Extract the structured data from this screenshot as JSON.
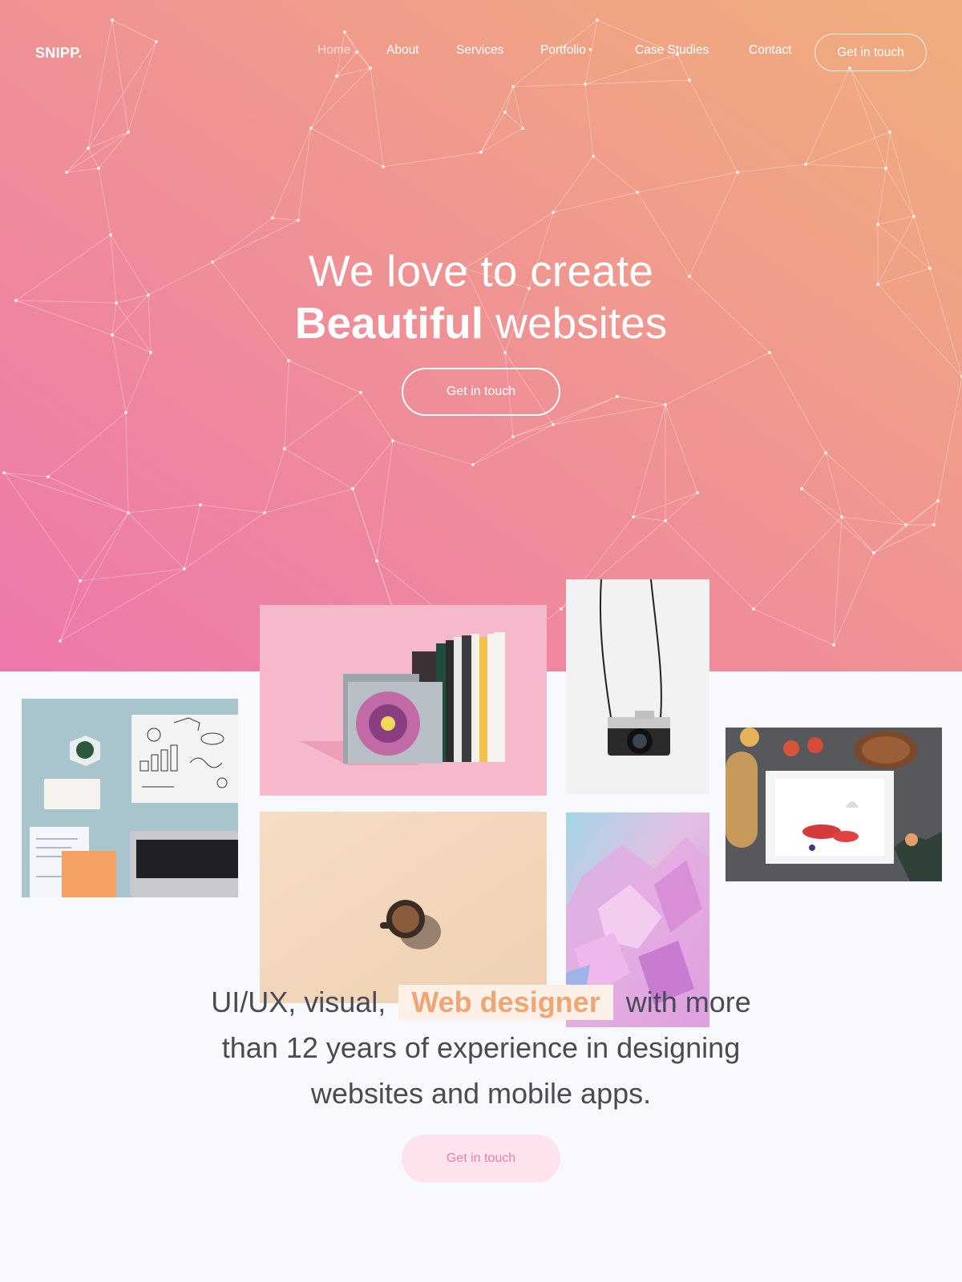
{
  "brand": {
    "logo_text": "SNIPP."
  },
  "nav": {
    "items": [
      {
        "label": "Home",
        "active": true
      },
      {
        "label": "About"
      },
      {
        "label": "Services"
      },
      {
        "label": "Portfolio",
        "has_dropdown": true
      },
      {
        "label": "Case Studies"
      },
      {
        "label": "Contact"
      }
    ],
    "cta_label": "Get in touch"
  },
  "hero": {
    "line1": "We love to create",
    "line2_bold": "Beautiful",
    "line2_rest": "websites",
    "cta_label": "Get in touch",
    "gradient": [
      "#ee77ac",
      "#f0ad7e"
    ]
  },
  "gallery": [
    {
      "subject": "desk with laptop and sketches"
    },
    {
      "subject": "books on pink background"
    },
    {
      "subject": "hanging film camera"
    },
    {
      "subject": "food and pie on dark table"
    },
    {
      "subject": "coffee cup on beige"
    },
    {
      "subject": "pink crystals"
    }
  ],
  "about": {
    "text_before": "UI/UX, visual,",
    "highlight": "Web designer",
    "text_after": "with more",
    "line2": "than 12 years of experience in designing",
    "line3": "websites and mobile apps.",
    "cta_label": "Get in touch",
    "highlight_color": "#efa574"
  }
}
